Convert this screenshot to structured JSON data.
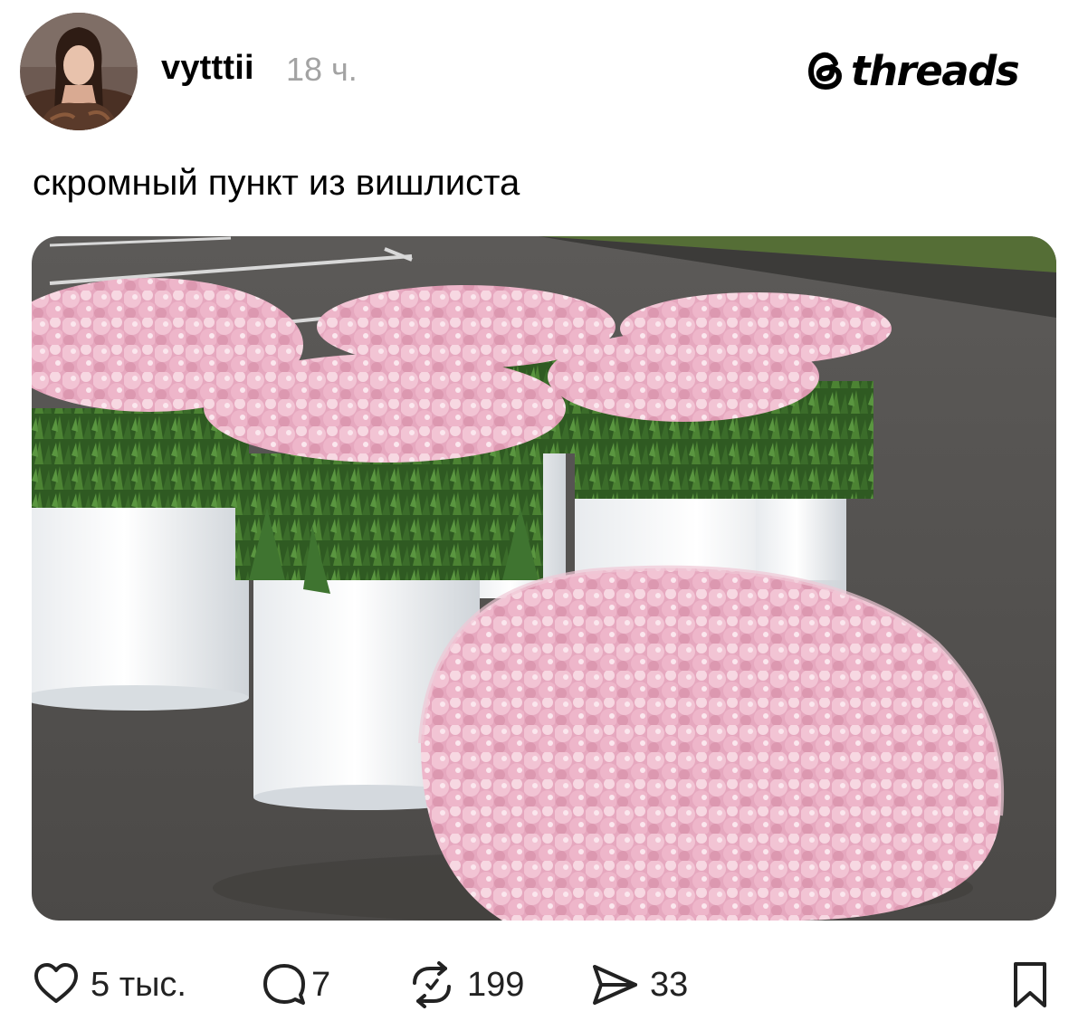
{
  "header": {
    "username": "vytttii",
    "timestamp": "18 ч.",
    "brand": "threads"
  },
  "post": {
    "text": "скромный пункт из вишлиста"
  },
  "actions": {
    "likes": "5 тыс.",
    "comments": "7",
    "reposts": "199",
    "shares": "33"
  },
  "icons": {
    "like": "heart-icon",
    "comment": "comment-bubble-icon",
    "repost": "repost-arrows-icon",
    "share": "send-plane-icon",
    "save": "bookmark-icon"
  },
  "colors": {
    "text": "#000000",
    "muted": "#a3a3a3",
    "icon": "#222222"
  }
}
